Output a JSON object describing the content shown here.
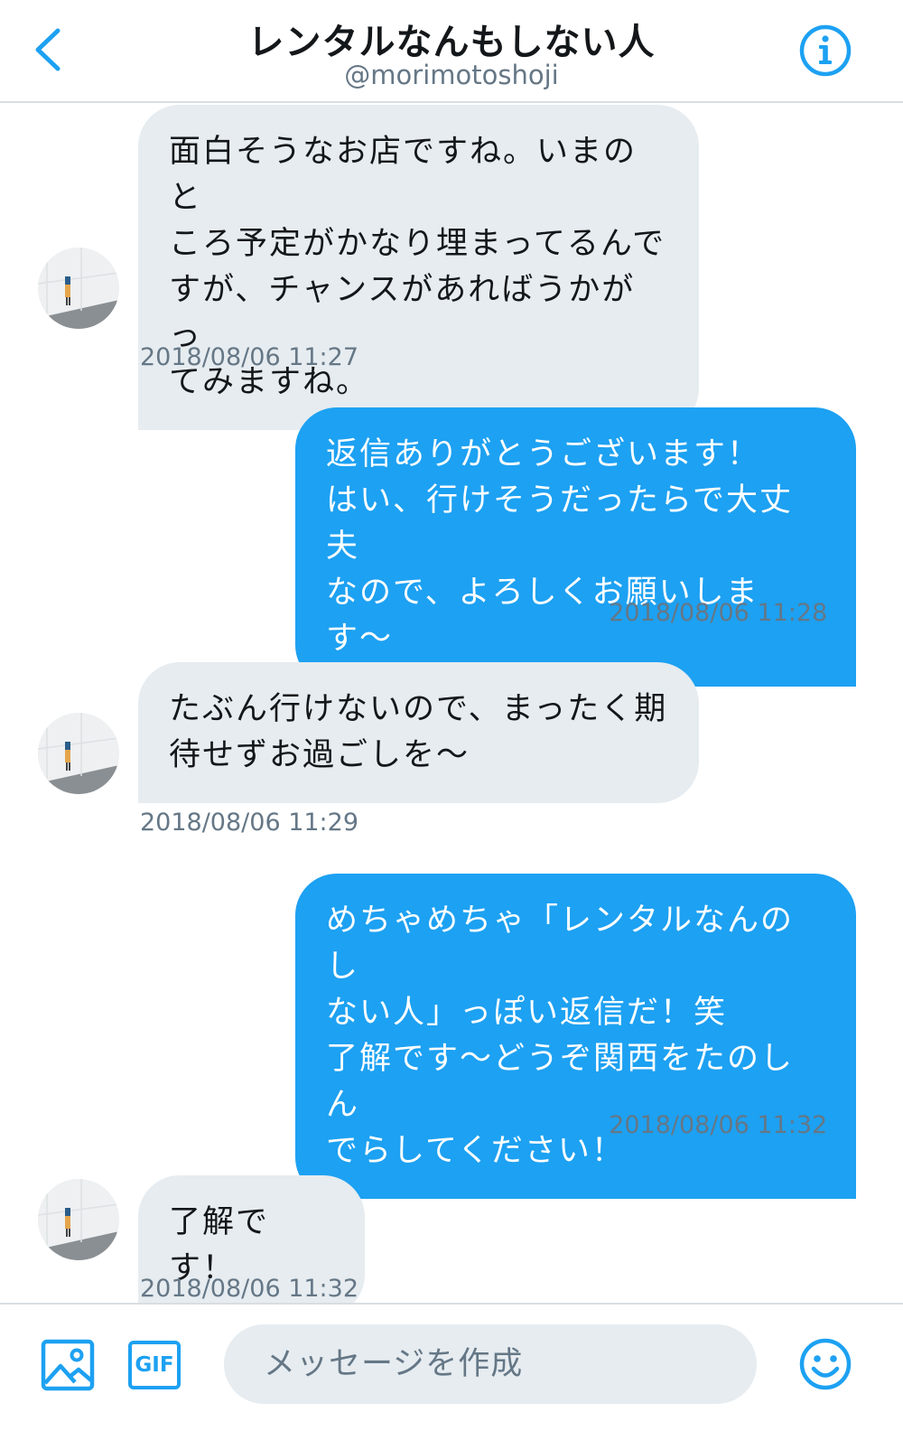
{
  "header": {
    "title": "レンタルなんもしない人",
    "handle": "@morimotoshoji",
    "back_icon": "chevron-left-icon",
    "info_icon": "info-icon"
  },
  "colors": {
    "accent": "#1da1f2",
    "incoming_bubble": "#e6ecf0",
    "timestamp": "#657786"
  },
  "messages": [
    {
      "direction": "incoming",
      "text": "面白そうなお店ですね。いまのと\nころ予定がかなり埋まってるんで\nすが、チャンスがあればうかがっ\nてみますね。",
      "timestamp": "2018/08/06 11:27"
    },
    {
      "direction": "outgoing",
      "text": "返信ありがとうございます！\nはい、行けそうだったらで大丈夫\nなので、よろしくお願いします〜",
      "timestamp": "2018/08/06 11:28",
      "read_mark": "✓"
    },
    {
      "direction": "incoming",
      "text": "たぶん行けないので、まったく期\n待せずお過ごしを〜",
      "timestamp": "2018/08/06 11:29"
    },
    {
      "direction": "outgoing",
      "text": "めちゃめちゃ「レンタルなんのし\nない人」っぽい返信だ！笑\n了解です〜どうぞ関西をたのしん\nでらしてください！",
      "timestamp": "2018/08/06 11:32",
      "read_mark": "✓"
    },
    {
      "direction": "incoming",
      "text": "了解です！",
      "timestamp": "2018/08/06 11:32"
    }
  ],
  "composer": {
    "gif_label": "GIF",
    "placeholder": "メッセージを作成",
    "media_icon": "image-icon",
    "emoji_icon": "emoji-icon"
  }
}
